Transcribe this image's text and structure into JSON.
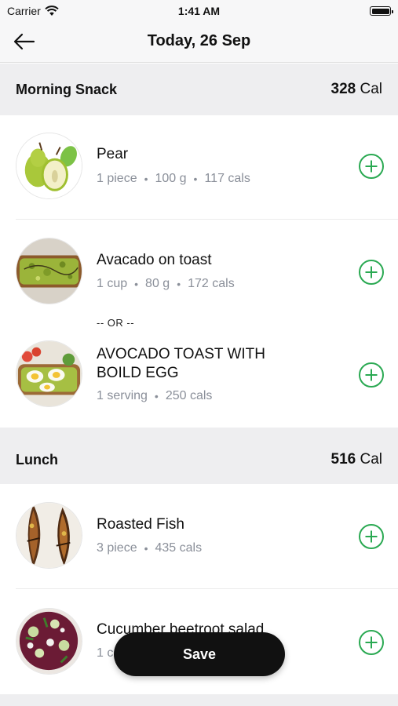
{
  "status": {
    "carrier": "Carrier",
    "time": "1:41 AM"
  },
  "nav": {
    "title": "Today, 26 Sep"
  },
  "sections": [
    {
      "title": "Morning Snack",
      "cal_value": "328",
      "cal_unit": "Cal",
      "items": [
        {
          "name": "Pear",
          "meta": [
            "1 piece",
            "100 g",
            "117 cals"
          ],
          "icon": "pear"
        },
        {
          "name": "Avacado on toast",
          "meta": [
            "1 cup",
            "80 g",
            "172 cals"
          ],
          "icon": "avocado-toast"
        },
        {
          "name": "AVOCADO TOAST WITH BOILD EGG",
          "meta": [
            "1 serving",
            "250 cals"
          ],
          "icon": "avocado-egg-toast"
        }
      ],
      "or_label": "-- OR --"
    },
    {
      "title": "Lunch",
      "cal_value": "516",
      "cal_unit": "Cal",
      "items": [
        {
          "name": "Roasted Fish",
          "meta": [
            "3 piece",
            "435 cals"
          ],
          "icon": "roasted-fish"
        },
        {
          "name": "Cucumber beetroot salad",
          "meta": [
            "1 c"
          ],
          "icon": "salad"
        }
      ]
    }
  ],
  "save_label": "Save",
  "colors": {
    "accent": "#2aa952",
    "header_bg": "#eeeef0",
    "button_bg": "#111111",
    "meta_text": "#8a8f99"
  }
}
